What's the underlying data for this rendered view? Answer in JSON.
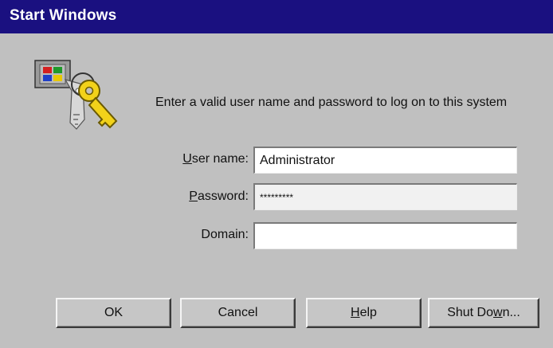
{
  "window": {
    "title": "Start Windows"
  },
  "prompt": "Enter a valid user name and password to log on to this system",
  "fields": {
    "username": {
      "label_accel": "U",
      "label_rest": "ser name:",
      "value": "Administrator"
    },
    "password": {
      "label_accel": "P",
      "label_rest": "assword:",
      "value": "*********"
    },
    "domain": {
      "label": "Domain:",
      "value": ""
    }
  },
  "buttons": {
    "ok": "OK",
    "cancel": "Cancel",
    "help_accel": "H",
    "help_rest": "elp",
    "shutdown_pre": "Shut Do",
    "shutdown_accel": "w",
    "shutdown_post": "n..."
  },
  "icons": {
    "logo": "windows-key-logo-icon"
  },
  "colors": {
    "titlebar": "#1a1080",
    "face": "#c0c0c0"
  }
}
